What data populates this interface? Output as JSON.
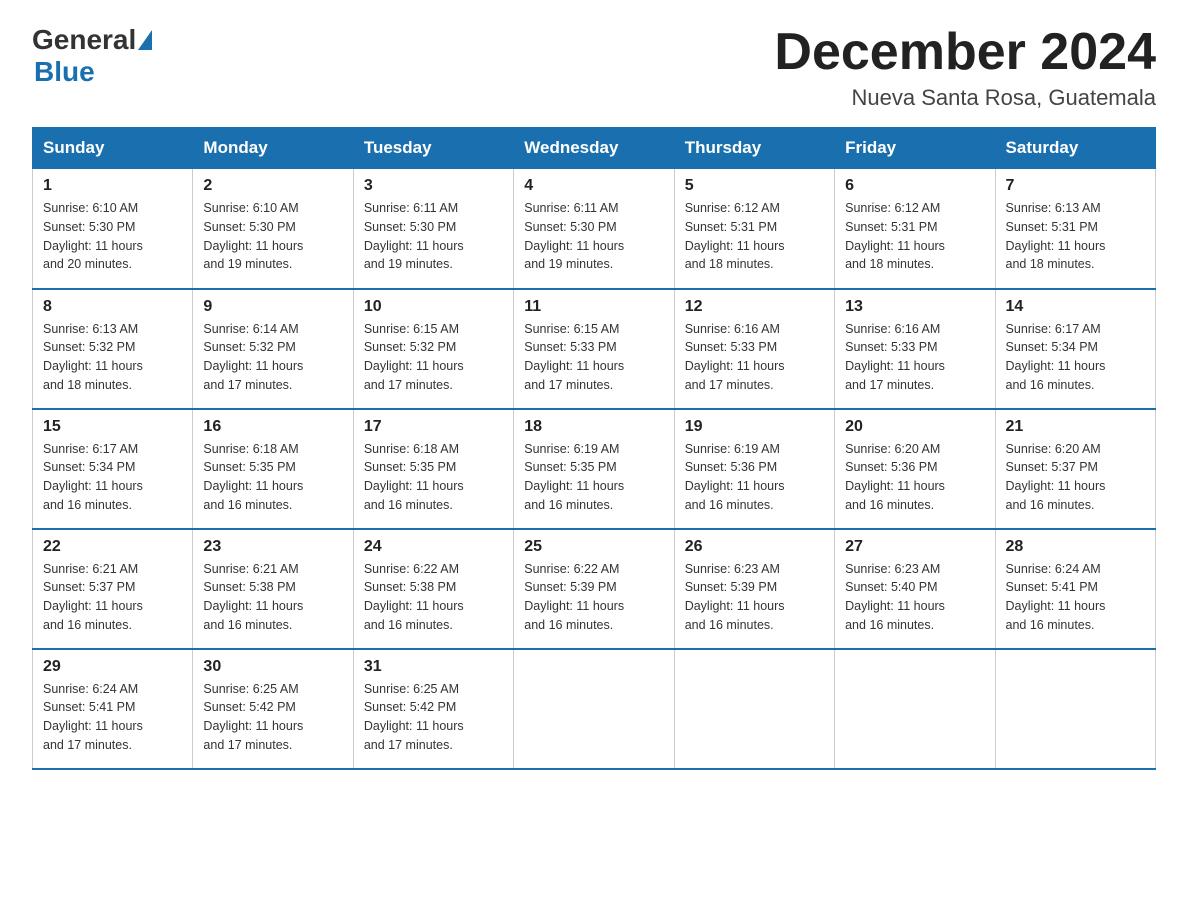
{
  "logo": {
    "general": "General",
    "blue": "Blue"
  },
  "header": {
    "month": "December 2024",
    "location": "Nueva Santa Rosa, Guatemala"
  },
  "days_of_week": [
    "Sunday",
    "Monday",
    "Tuesday",
    "Wednesday",
    "Thursday",
    "Friday",
    "Saturday"
  ],
  "weeks": [
    [
      {
        "day": "1",
        "sunrise": "6:10 AM",
        "sunset": "5:30 PM",
        "daylight": "11 hours and 20 minutes."
      },
      {
        "day": "2",
        "sunrise": "6:10 AM",
        "sunset": "5:30 PM",
        "daylight": "11 hours and 19 minutes."
      },
      {
        "day": "3",
        "sunrise": "6:11 AM",
        "sunset": "5:30 PM",
        "daylight": "11 hours and 19 minutes."
      },
      {
        "day": "4",
        "sunrise": "6:11 AM",
        "sunset": "5:30 PM",
        "daylight": "11 hours and 19 minutes."
      },
      {
        "day": "5",
        "sunrise": "6:12 AM",
        "sunset": "5:31 PM",
        "daylight": "11 hours and 18 minutes."
      },
      {
        "day": "6",
        "sunrise": "6:12 AM",
        "sunset": "5:31 PM",
        "daylight": "11 hours and 18 minutes."
      },
      {
        "day": "7",
        "sunrise": "6:13 AM",
        "sunset": "5:31 PM",
        "daylight": "11 hours and 18 minutes."
      }
    ],
    [
      {
        "day": "8",
        "sunrise": "6:13 AM",
        "sunset": "5:32 PM",
        "daylight": "11 hours and 18 minutes."
      },
      {
        "day": "9",
        "sunrise": "6:14 AM",
        "sunset": "5:32 PM",
        "daylight": "11 hours and 17 minutes."
      },
      {
        "day": "10",
        "sunrise": "6:15 AM",
        "sunset": "5:32 PM",
        "daylight": "11 hours and 17 minutes."
      },
      {
        "day": "11",
        "sunrise": "6:15 AM",
        "sunset": "5:33 PM",
        "daylight": "11 hours and 17 minutes."
      },
      {
        "day": "12",
        "sunrise": "6:16 AM",
        "sunset": "5:33 PM",
        "daylight": "11 hours and 17 minutes."
      },
      {
        "day": "13",
        "sunrise": "6:16 AM",
        "sunset": "5:33 PM",
        "daylight": "11 hours and 17 minutes."
      },
      {
        "day": "14",
        "sunrise": "6:17 AM",
        "sunset": "5:34 PM",
        "daylight": "11 hours and 16 minutes."
      }
    ],
    [
      {
        "day": "15",
        "sunrise": "6:17 AM",
        "sunset": "5:34 PM",
        "daylight": "11 hours and 16 minutes."
      },
      {
        "day": "16",
        "sunrise": "6:18 AM",
        "sunset": "5:35 PM",
        "daylight": "11 hours and 16 minutes."
      },
      {
        "day": "17",
        "sunrise": "6:18 AM",
        "sunset": "5:35 PM",
        "daylight": "11 hours and 16 minutes."
      },
      {
        "day": "18",
        "sunrise": "6:19 AM",
        "sunset": "5:35 PM",
        "daylight": "11 hours and 16 minutes."
      },
      {
        "day": "19",
        "sunrise": "6:19 AM",
        "sunset": "5:36 PM",
        "daylight": "11 hours and 16 minutes."
      },
      {
        "day": "20",
        "sunrise": "6:20 AM",
        "sunset": "5:36 PM",
        "daylight": "11 hours and 16 minutes."
      },
      {
        "day": "21",
        "sunrise": "6:20 AM",
        "sunset": "5:37 PM",
        "daylight": "11 hours and 16 minutes."
      }
    ],
    [
      {
        "day": "22",
        "sunrise": "6:21 AM",
        "sunset": "5:37 PM",
        "daylight": "11 hours and 16 minutes."
      },
      {
        "day": "23",
        "sunrise": "6:21 AM",
        "sunset": "5:38 PM",
        "daylight": "11 hours and 16 minutes."
      },
      {
        "day": "24",
        "sunrise": "6:22 AM",
        "sunset": "5:38 PM",
        "daylight": "11 hours and 16 minutes."
      },
      {
        "day": "25",
        "sunrise": "6:22 AM",
        "sunset": "5:39 PM",
        "daylight": "11 hours and 16 minutes."
      },
      {
        "day": "26",
        "sunrise": "6:23 AM",
        "sunset": "5:39 PM",
        "daylight": "11 hours and 16 minutes."
      },
      {
        "day": "27",
        "sunrise": "6:23 AM",
        "sunset": "5:40 PM",
        "daylight": "11 hours and 16 minutes."
      },
      {
        "day": "28",
        "sunrise": "6:24 AM",
        "sunset": "5:41 PM",
        "daylight": "11 hours and 16 minutes."
      }
    ],
    [
      {
        "day": "29",
        "sunrise": "6:24 AM",
        "sunset": "5:41 PM",
        "daylight": "11 hours and 17 minutes."
      },
      {
        "day": "30",
        "sunrise": "6:25 AM",
        "sunset": "5:42 PM",
        "daylight": "11 hours and 17 minutes."
      },
      {
        "day": "31",
        "sunrise": "6:25 AM",
        "sunset": "5:42 PM",
        "daylight": "11 hours and 17 minutes."
      },
      null,
      null,
      null,
      null
    ]
  ],
  "labels": {
    "sunrise": "Sunrise:",
    "sunset": "Sunset:",
    "daylight": "Daylight:"
  }
}
